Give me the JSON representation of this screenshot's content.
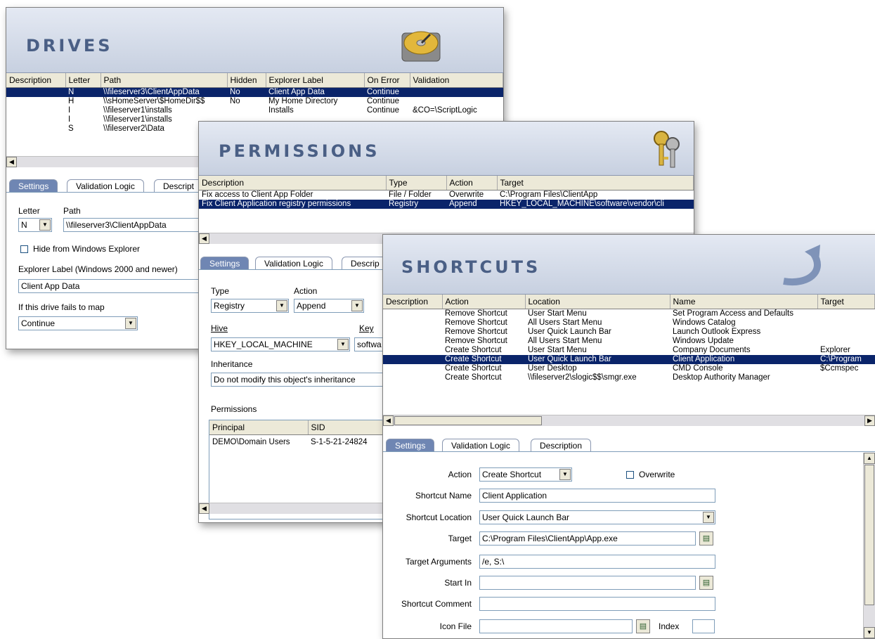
{
  "drives": {
    "title": "DRIVES",
    "columns": [
      "Description",
      "Letter",
      "Path",
      "Hidden",
      "Explorer Label",
      "On Error",
      "Validation"
    ],
    "rows": [
      {
        "description": "",
        "letter": "N",
        "path": "\\\\fileserver3\\ClientAppData",
        "hidden": "No",
        "label": "Client App Data",
        "on_error": "Continue",
        "validation": ""
      },
      {
        "description": "",
        "letter": "H",
        "path": "\\\\sHomeServer\\$HomeDir$$",
        "hidden": "No",
        "label": "My Home Directory",
        "on_error": "Continue",
        "validation": ""
      },
      {
        "description": "",
        "letter": "I",
        "path": "\\\\fileserver1\\installs",
        "hidden": "",
        "label": "Installs",
        "on_error": "Continue",
        "validation": "&CO=\\ScriptLogic"
      },
      {
        "description": "",
        "letter": "I",
        "path": "\\\\fileserver1\\installs",
        "hidden": "",
        "label": "",
        "on_error": "",
        "validation": ""
      },
      {
        "description": "",
        "letter": "S",
        "path": "\\\\fileserver2\\Data",
        "hidden": "",
        "label": "",
        "on_error": "",
        "validation": ""
      }
    ],
    "tabs": [
      "Settings",
      "Validation Logic",
      "Descript"
    ],
    "letter_label": "Letter",
    "letter_value": "N",
    "path_label": "Path",
    "path_value": "\\\\fileserver3\\ClientAppData",
    "hide_label": "Hide from Windows Explorer",
    "explorer_label": "Explorer Label (Windows 2000 and newer)",
    "explorer_value": "Client App Data",
    "fail_label": "If this drive fails to map",
    "fail_value": "Continue"
  },
  "permissions": {
    "title": "PERMISSIONS",
    "columns": [
      "Description",
      "Type",
      "Action",
      "Target"
    ],
    "rows": [
      {
        "description": "Fix access to Client App Folder",
        "type": "File / Folder",
        "action": "Overwrite",
        "target": "C:\\Program Files\\ClientApp"
      },
      {
        "description": "Fix Client Application registry permissions",
        "type": "Registry",
        "action": "Append",
        "target": "HKEY_LOCAL_MACHINE\\software\\vendor\\cli"
      }
    ],
    "tabs": [
      "Settings",
      "Validation Logic",
      "Descrip"
    ],
    "type_label": "Type",
    "type_value": "Registry",
    "action_label": "Action",
    "action_value": "Append",
    "hive_label": "Hive",
    "hive_value": "HKEY_LOCAL_MACHINE",
    "key_label": "Key",
    "key_value": "softwa",
    "inheritance_label": "Inheritance",
    "inheritance_value": "Do not modify this object's inheritance",
    "perms_label": "Permissions",
    "perm_columns": [
      "Principal",
      "SID"
    ],
    "perm_rows": [
      {
        "principal": "DEMO\\Domain Users",
        "sid": "S-1-5-21-24824"
      }
    ]
  },
  "shortcuts": {
    "title": "SHORTCUTS",
    "columns": [
      "Description",
      "Action",
      "Location",
      "Name",
      "Target"
    ],
    "rows": [
      {
        "description": "",
        "action": "Remove Shortcut",
        "location": "User Start Menu",
        "name": "Set Program Access and Defaults",
        "target": ""
      },
      {
        "description": "",
        "action": "Remove Shortcut",
        "location": "All Users Start Menu",
        "name": "Windows Catalog",
        "target": ""
      },
      {
        "description": "",
        "action": "Remove Shortcut",
        "location": "User Quick Launch Bar",
        "name": "Launch Outlook Express",
        "target": ""
      },
      {
        "description": "",
        "action": "Remove Shortcut",
        "location": "All Users Start Menu",
        "name": "Windows Update",
        "target": ""
      },
      {
        "description": "",
        "action": "Create Shortcut",
        "location": "User Start Menu",
        "name": "Company Documents",
        "target": "Explorer"
      },
      {
        "description": "",
        "action": "Create Shortcut",
        "location": "User Quick Launch Bar",
        "name": "Client Application",
        "target": "C:\\Program"
      },
      {
        "description": "",
        "action": "Create Shortcut",
        "location": "User Desktop",
        "name": "CMD Console",
        "target": "$Ccmspec"
      },
      {
        "description": "",
        "action": "Create Shortcut",
        "location": "\\\\fileserver2\\slogic$$\\smgr.exe",
        "name": "Desktop Authority Manager",
        "target": ""
      }
    ],
    "tabs": [
      "Settings",
      "Validation Logic",
      "Description"
    ],
    "action_label": "Action",
    "action_value": "Create Shortcut",
    "overwrite_label": "Overwrite",
    "name_label": "Shortcut Name",
    "name_value": "Client Application",
    "location_label": "Shortcut Location",
    "location_value": "User Quick Launch Bar",
    "target_label": "Target",
    "target_value": "C:\\Program Files\\ClientApp\\App.exe",
    "args_label": "Target Arguments",
    "args_value": "/e, S:\\",
    "startin_label": "Start In",
    "startin_value": "",
    "comment_label": "Shortcut Comment",
    "comment_value": "",
    "iconfile_label": "Icon File",
    "iconfile_value": "",
    "index_label": "Index",
    "index_value": ""
  },
  "colors": {
    "selection": "#0a246a",
    "banner_text": "#4a5f85",
    "active_tab": "#6f86b3"
  }
}
